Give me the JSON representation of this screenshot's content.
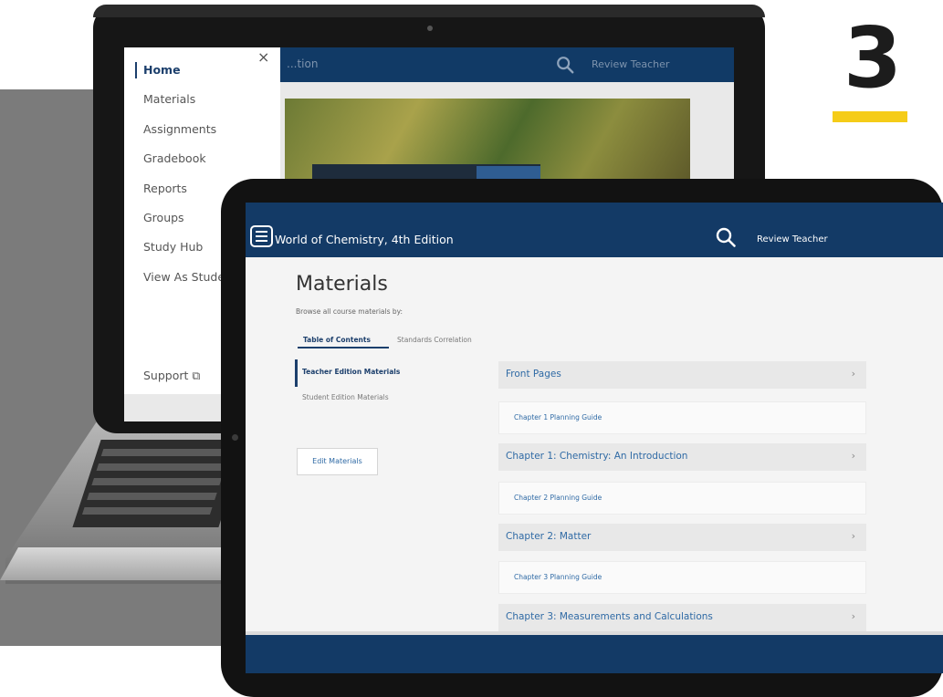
{
  "step": {
    "number": "3",
    "accent_color": "#f5cc18"
  },
  "laptop": {
    "menu": {
      "items": [
        {
          "label": "Home",
          "active": true
        },
        {
          "label": "Materials"
        },
        {
          "label": "Assignments"
        },
        {
          "label": "Gradebook"
        },
        {
          "label": "Reports"
        },
        {
          "label": "Groups"
        },
        {
          "label": "Study Hub"
        },
        {
          "label": "View As Studer"
        }
      ],
      "support_label": "Support ⧉",
      "close_glyph": "×"
    },
    "topbar_text": "...tion",
    "user_text": "Review Teacher"
  },
  "tablet": {
    "header": {
      "course_title": "World of Chemistry, 4th Edition",
      "user_label": "Review Teacher",
      "brand_color": "#133a66"
    },
    "page_title": "Materials",
    "browse_label": "Browse all course materials by:",
    "tabs": [
      {
        "label": "Table of Contents",
        "active": true
      },
      {
        "label": "Standards Correlation"
      }
    ],
    "left_nav": [
      {
        "label": "Teacher Edition Materials",
        "active": true
      },
      {
        "label": "Student Edition Materials"
      }
    ],
    "edit_button": "Edit Materials",
    "chevron_glyph": "›",
    "rows": [
      {
        "header": "Front Pages",
        "sub": "Chapter 1 Planning Guide"
      },
      {
        "header": "Chapter 1: Chemistry: An Introduction",
        "sub": "Chapter 2 Planning Guide"
      },
      {
        "header": "Chapter 2: Matter",
        "sub": "Chapter 3 Planning Guide"
      },
      {
        "header": "Chapter 3: Measurements and Calculations"
      }
    ]
  }
}
